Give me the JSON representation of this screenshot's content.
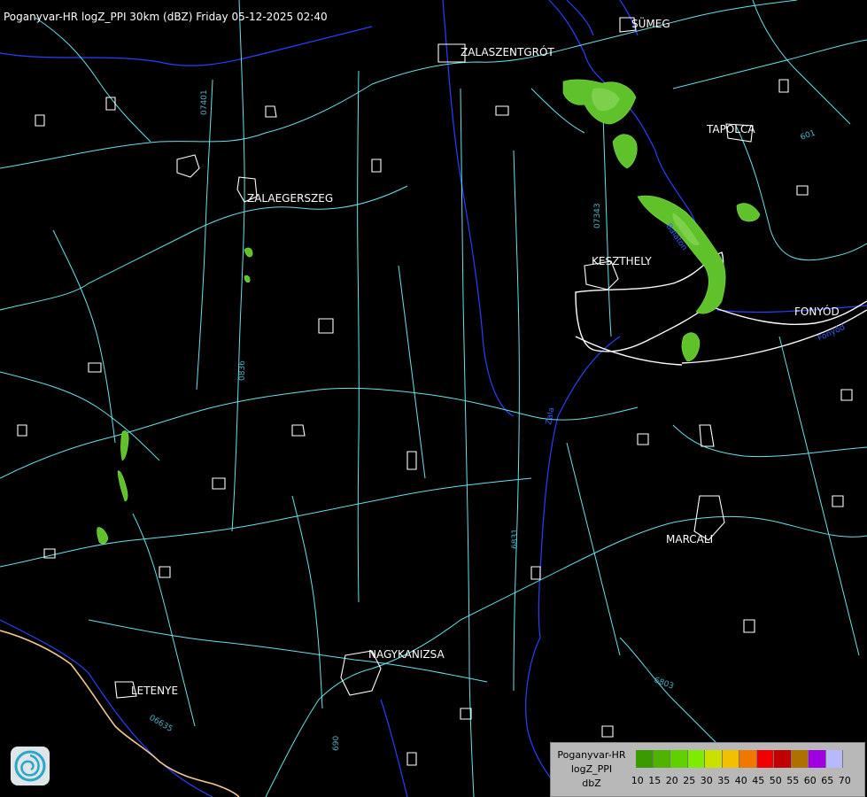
{
  "header": {
    "title": "Poganyvar-HR logZ_PPI 30km (dBZ) Friday 05-12-2025 02:40"
  },
  "cities": [
    {
      "name": "SÜMEG"
    },
    {
      "name": "ZALASZENTGRÓT"
    },
    {
      "name": "TAPOLCA"
    },
    {
      "name": "ZALAEGERSZEG"
    },
    {
      "name": "KESZTHELY"
    },
    {
      "name": "FONYÓD"
    },
    {
      "name": "MARCALI"
    },
    {
      "name": "NAGYKANIZSA"
    },
    {
      "name": "LETENYE"
    }
  ],
  "road_labels": [
    {
      "text": "07401"
    },
    {
      "text": "07343"
    },
    {
      "text": "0836"
    },
    {
      "text": "6831"
    },
    {
      "text": "6803"
    },
    {
      "text": "06635"
    },
    {
      "text": "690"
    },
    {
      "text": "601"
    }
  ],
  "river_labels": [
    {
      "text": "Zala"
    },
    {
      "text": "Balaton"
    },
    {
      "text": "Fonyód"
    }
  ],
  "legend": {
    "line1": "Poganyvar-HR",
    "line2": "logZ_PPI",
    "line3": "dbZ",
    "colors": [
      "#3a9a00",
      "#4fb400",
      "#5fd000",
      "#7cec00",
      "#c9e000",
      "#f2c000",
      "#f07800",
      "#f00000",
      "#c00000",
      "#b07000",
      "#a000e0",
      "#b8b8ff"
    ],
    "ticks": [
      "10",
      "15",
      "20",
      "25",
      "30",
      "35",
      "40",
      "45",
      "50",
      "55",
      "60",
      "65",
      "70"
    ]
  },
  "colors": {
    "background": "#000000",
    "roads": "#66e3e8",
    "rivers": "#2a3fff",
    "settlements": "#ffffff",
    "border": "#f4c88e",
    "echo": "#6fc83a"
  },
  "icons": {
    "logo": "radar-swirl-logo"
  }
}
